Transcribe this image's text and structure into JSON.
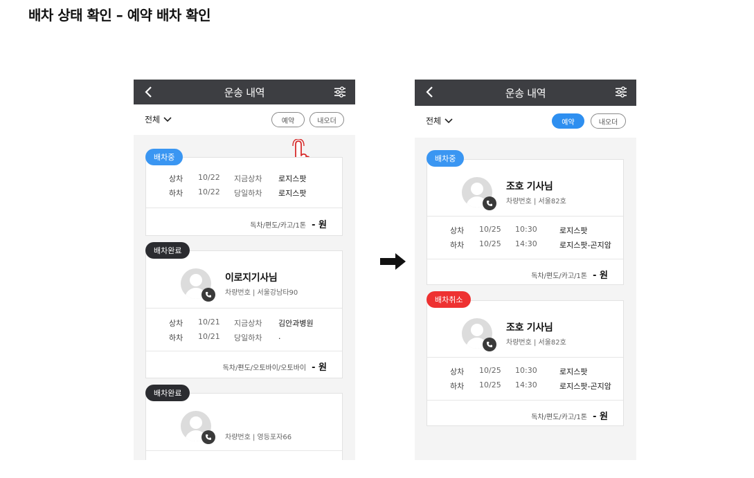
{
  "heading": "배차 상태 확인 – 예약 배차 확인",
  "colors": {
    "appbar": "#3d3e42",
    "accent": "#2e8ff0",
    "cancel": "#ee3131",
    "done": "#2b2c30"
  },
  "left": {
    "appbar": {
      "title": "운송 내역",
      "back_icon": "chevron-left-icon",
      "filter_icon": "sliders-icon"
    },
    "filter": {
      "dropdown": "전체",
      "pill_reserve": "예약",
      "pill_myorder": "내오더"
    },
    "cards": [
      {
        "badge": "배차중",
        "rows": [
          {
            "type": "상차",
            "date": "10/22",
            "time": "지금상차",
            "place": "로지스팟"
          },
          {
            "type": "하차",
            "date": "10/22",
            "time": "당일하차",
            "place": "로지스팟"
          }
        ],
        "cargo": "독차/편도/카고/1톤",
        "price": "- 원"
      },
      {
        "badge": "배차완료",
        "driver_name": "이로지기사님",
        "plate": "차량번호 | 서울강남타90",
        "rows": [
          {
            "type": "상차",
            "date": "10/21",
            "time": "지금상차",
            "place": "김안과병원"
          },
          {
            "type": "하차",
            "date": "10/21",
            "time": "당일하차",
            "place": "."
          }
        ],
        "cargo": "독차/편도/오토바이/오토바이",
        "price": "- 원"
      },
      {
        "badge": "배차완료",
        "plate": "차량번호 | 영등포자66"
      }
    ]
  },
  "right": {
    "appbar": {
      "title": "운송 내역",
      "back_icon": "chevron-left-icon",
      "filter_icon": "sliders-icon"
    },
    "filter": {
      "dropdown": "전체",
      "pill_reserve": "예약",
      "pill_myorder": "내오더"
    },
    "cards": [
      {
        "badge": "배차중",
        "driver_name": "조호 기사님",
        "plate": "차량번호 | 서울82호",
        "rows": [
          {
            "type": "상차",
            "date": "10/25",
            "time": "10:30",
            "place": "로지스팟"
          },
          {
            "type": "하차",
            "date": "10/25",
            "time": "14:30",
            "place": "로지스팟-곤지암"
          }
        ],
        "cargo": "독차/편도/카고/1톤",
        "price": "- 원"
      },
      {
        "badge": "배차취소",
        "driver_name": "조호 기사님",
        "plate": "차량번호 | 서울82호",
        "rows": [
          {
            "type": "상차",
            "date": "10/25",
            "time": "10:30",
            "place": "로지스팟"
          },
          {
            "type": "하차",
            "date": "10/25",
            "time": "14:30",
            "place": "로지스팟-곤지암"
          }
        ],
        "cargo": "독차/편도/카고/1톤",
        "price": "- 원"
      }
    ]
  }
}
